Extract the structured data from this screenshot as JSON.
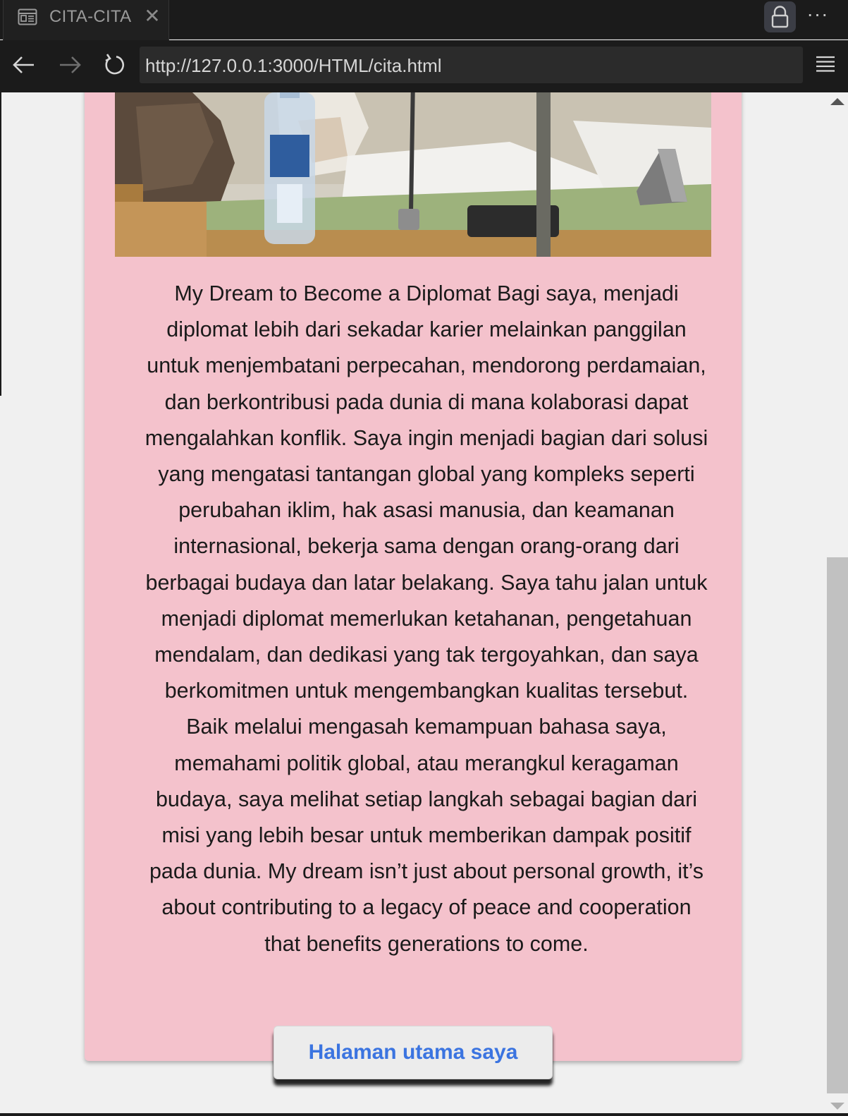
{
  "browser": {
    "tab_title": "CITA-CITA",
    "tab_close": "✕",
    "url": "http://127.0.0.1:3000/HTML/cita.html",
    "more_label": "···",
    "icons": {
      "tab": "reader-view-icon",
      "close": "close-icon",
      "lock": "lock-icon",
      "more": "more-icon",
      "back": "back-arrow-icon",
      "forward": "forward-arrow-icon",
      "reload": "reload-icon",
      "menu": "menu-icon"
    }
  },
  "page": {
    "paragraph": "My Dream to Become a Diplomat Bagi saya, menjadi diplomat lebih dari sekadar karier melainkan panggilan untuk menjembatani perpecahan, mendorong perdamaian, dan berkontribusi pada dunia di mana kolaborasi dapat mengalahkan konflik. Saya ingin menjadi bagian dari solusi yang mengatasi tantangan global yang kompleks seperti perubahan iklim, hak asasi manusia, dan keamanan internasional, bekerja sama dengan orang-orang dari berbagai budaya dan latar belakang. Saya tahu jalan untuk menjadi diplomat memerlukan ketahanan, pengetahuan mendalam, dan dedikasi yang tak tergoyahkan, dan saya berkomitmen untuk mengembangkan kualitas tersebut. Baik melalui mengasah kemampuan bahasa saya, memahami politik global, atau merangkul keragaman budaya, saya melihat setiap langkah sebagai bagian dari misi yang lebih besar untuk memberikan dampak positif pada dunia. My dream isn’t just about personal growth, it’s about contributing to a legacy of peace and cooperation that benefits generations to come.",
    "home_button": "Halaman utama saya"
  },
  "colors": {
    "card_background": "#f4c2cc",
    "page_background": "#f0f0f0",
    "link_blue": "#3b74e0",
    "chrome_dark": "#1b1b1b"
  }
}
